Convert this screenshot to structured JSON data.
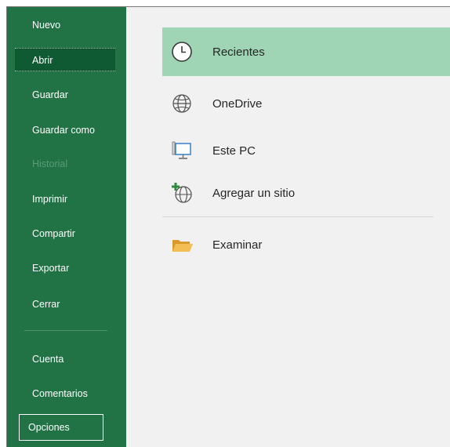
{
  "sidebar": {
    "items": [
      {
        "label": "Nuevo"
      },
      {
        "label": "Abrir"
      },
      {
        "label": "Guardar"
      },
      {
        "label": "Guardar como"
      },
      {
        "label": "Historial"
      },
      {
        "label": "Imprimir"
      },
      {
        "label": "Compartir"
      },
      {
        "label": "Exportar"
      },
      {
        "label": "Cerrar"
      },
      {
        "label": "Cuenta"
      },
      {
        "label": "Comentarios"
      },
      {
        "label": "Opciones"
      }
    ]
  },
  "places": [
    {
      "label": "Recientes",
      "icon": "clock-icon"
    },
    {
      "label": "OneDrive",
      "icon": "globe-icon"
    },
    {
      "label": "Este PC",
      "icon": "computer-icon"
    },
    {
      "label": "Agregar un sitio",
      "icon": "add-place-icon"
    },
    {
      "label": "Examinar",
      "icon": "folder-icon"
    }
  ],
  "colors": {
    "sidebar": "#217346",
    "sidebar_selected": "#0f5a32",
    "selected_place": "#9fd5b5",
    "main_bg": "#f1f1f1"
  }
}
